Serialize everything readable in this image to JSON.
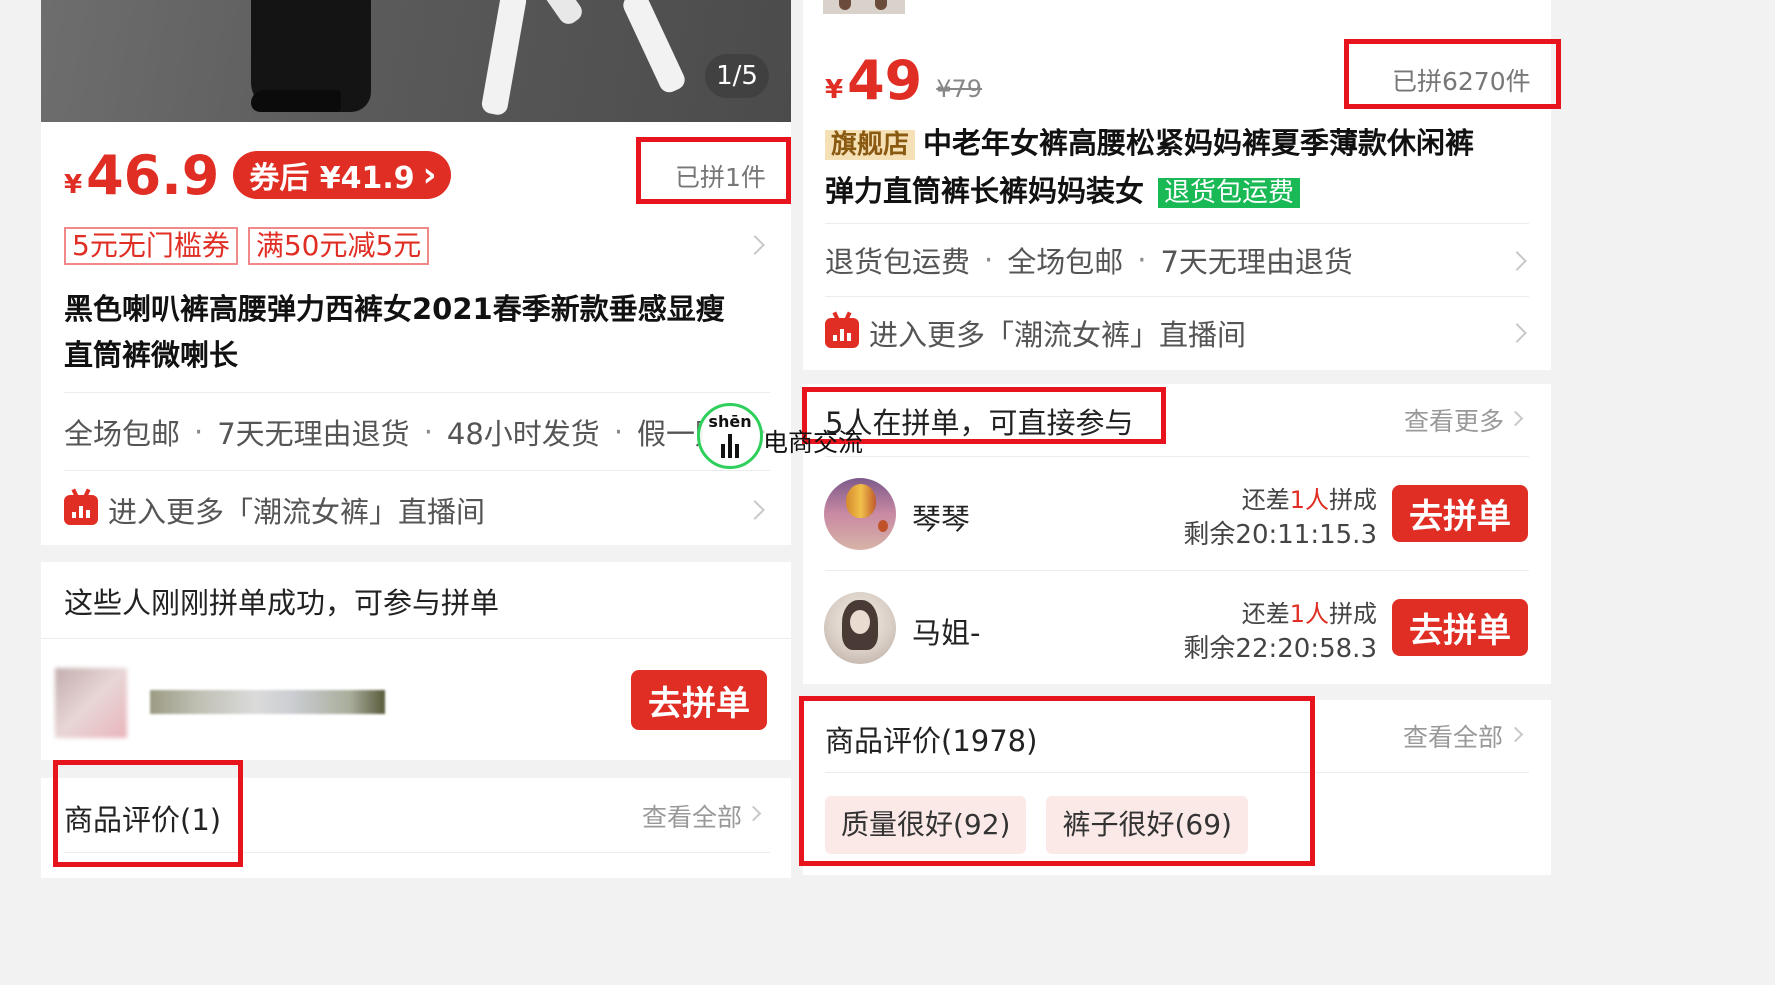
{
  "left": {
    "gallery": {
      "counter": "1/5"
    },
    "price": {
      "currency": "¥",
      "value": "46.9",
      "coupon_badge": "券后 ¥41.9",
      "coupon_arrow": "›"
    },
    "sold": "已拼1件",
    "coupons": [
      "5元无门槛券",
      "满50元减5元"
    ],
    "title_line1": "黑色喇叭裤高腰弹力西裤女2021春季新款垂感显瘦",
    "title_line2": "直筒裤微喇长",
    "services": [
      "全场包邮",
      "7天无理由退货",
      "48小时发货",
      "假一赔十"
    ],
    "live": "进入更多「潮流女裤」直播间",
    "recent_title": "这些人刚刚拼单成功，可参与拼单",
    "join_label": "去拼单",
    "reviews_title": "商品评价(1)",
    "view_all": "查看全部"
  },
  "right": {
    "price": {
      "currency": "¥",
      "value": "49",
      "original": "¥79"
    },
    "sold": "已拼6270件",
    "store_badge": "旗舰店",
    "title_line1": "中老年女裤高腰松紧妈妈裤夏季薄款休闲裤",
    "title_line2": "弹力直筒裤长裤妈妈装女",
    "return_badge": "退货包运费",
    "services": [
      "退货包运费",
      "全场包邮",
      "7天无理由退货"
    ],
    "live": "进入更多「潮流女裤」直播间",
    "group_title": "5人在拼单，可直接参与",
    "view_more": "查看更多",
    "groups": [
      {
        "name": "琴琴",
        "need_prefix": "还差",
        "need_count": "1人",
        "need_suffix": "拼成",
        "remaining": "剩余20:11:15.3",
        "join_label": "去拼单"
      },
      {
        "name": "马姐-",
        "need_prefix": "还差",
        "need_count": "1人",
        "need_suffix": "拼成",
        "remaining": "剩余22:20:58.3",
        "join_label": "去拼单"
      }
    ],
    "reviews_title": "商品评价(1978)",
    "view_all": "查看全部",
    "review_tags": [
      "质量很好(92)",
      "裤子很好(69)"
    ]
  },
  "watermark": {
    "pinyin": "shēn",
    "text": "电商交流"
  },
  "colors": {
    "accent": "#e02e24",
    "highlight_box": "#e8141d",
    "store_badge_bg": "#f6e1b6",
    "return_badge_bg": "#19b955"
  }
}
